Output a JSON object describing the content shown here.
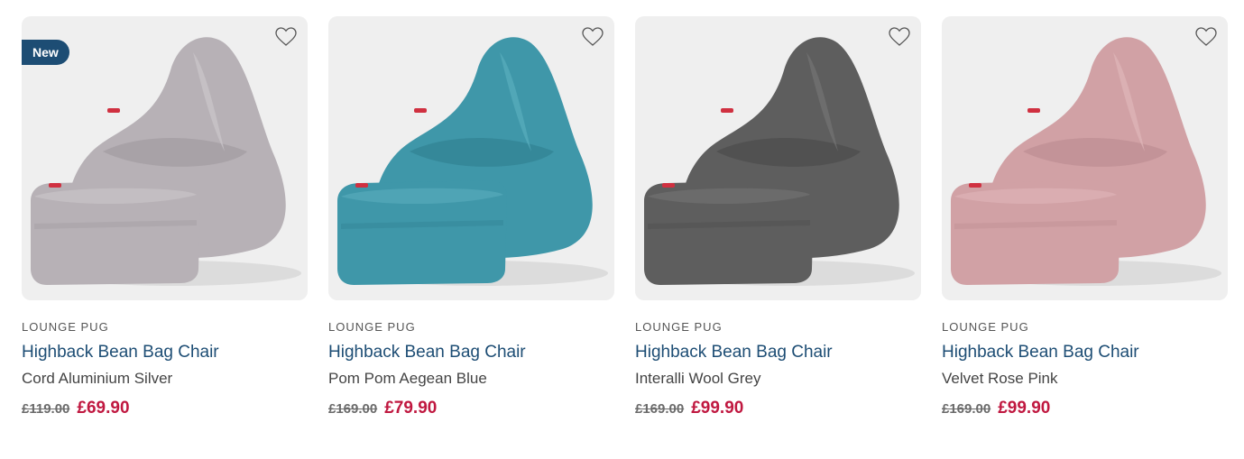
{
  "products": [
    {
      "badge": "New",
      "brand": "LOUNGE PUG",
      "title": "Highback Bean Bag Chair",
      "variant": "Cord Aluminium Silver",
      "was_price": "£119.00",
      "now_price": "£69.90",
      "colors": {
        "main": "#b7b1b6",
        "shade": "#9e989d",
        "light": "#cbc6ca"
      },
      "wishlist_icon": "heart-outline-icon"
    },
    {
      "brand": "LOUNGE PUG",
      "title": "Highback Bean Bag Chair",
      "variant": "Pom Pom Aegean Blue",
      "was_price": "£169.00",
      "now_price": "£79.90",
      "colors": {
        "main": "#3f97a9",
        "shade": "#2f7f90",
        "light": "#5aaebe"
      },
      "wishlist_icon": "heart-outline-icon"
    },
    {
      "brand": "LOUNGE PUG",
      "title": "Highback Bean Bag Chair",
      "variant": "Interalli Wool Grey",
      "was_price": "£169.00",
      "now_price": "£99.90",
      "colors": {
        "main": "#5e5e5e",
        "shade": "#4a4a4a",
        "light": "#747474"
      },
      "wishlist_icon": "heart-outline-icon"
    },
    {
      "brand": "LOUNGE PUG",
      "title": "Highback Bean Bag Chair",
      "variant": "Velvet Rose Pink",
      "was_price": "£169.00",
      "now_price": "£99.90",
      "colors": {
        "main": "#d1a1a5",
        "shade": "#b98a8f",
        "light": "#e0b6b9"
      },
      "wishlist_icon": "heart-outline-icon"
    }
  ]
}
